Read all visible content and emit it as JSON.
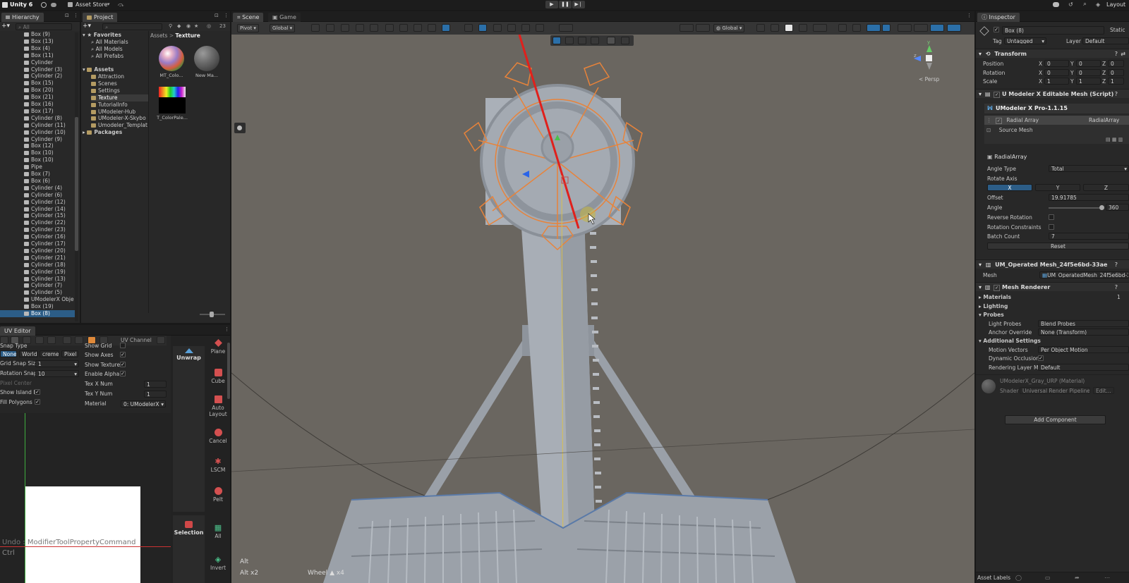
{
  "topbar": {
    "app": "Unity 6",
    "asset_store": "Asset Store",
    "layout": "Layout"
  },
  "hierarchy": {
    "tab": "Hierarchy",
    "search_placeholder": "All",
    "items": [
      "Box (9)",
      "Box (13)",
      "Box (4)",
      "Box (11)",
      "Cylinder",
      "Cylinder (3)",
      "Cylinder (2)",
      "Box (15)",
      "Box (20)",
      "Box (21)",
      "Box (16)",
      "Box (17)",
      "Cylinder (8)",
      "Cylinder (11)",
      "Cylinder (10)",
      "Cylinder (9)",
      "Box (12)",
      "Box (10)",
      "Box (10)",
      "Pipe",
      "Box (7)",
      "Box (6)",
      "Cylinder (4)",
      "Cylinder (6)",
      "Cylinder (12)",
      "Cylinder (14)",
      "Cylinder (15)",
      "Cylinder (22)",
      "Cylinder (23)",
      "Cylinder (16)",
      "Cylinder (17)",
      "Cylinder (20)",
      "Cylinder (21)",
      "Cylinder (18)",
      "Cylinder (19)",
      "Cylinder (13)",
      "Cylinder (7)",
      "Cylinder (5)",
      "UModelerX Obje",
      "Box (19)",
      "Box (8)"
    ],
    "selected_index": 40
  },
  "project": {
    "tab": "Project",
    "count": "23",
    "favorites": "Favorites",
    "fav_items": [
      "All Materials",
      "All Models",
      "All Prefabs"
    ],
    "assets": "Assets",
    "asset_folders": [
      "Attraction",
      "Scenes",
      "Settings",
      "Texture",
      "TutorialInfo",
      "UModeler-Hub",
      "UModeler-X-Skybo",
      "Umodeler_Templat"
    ],
    "selected_folder": "Texture",
    "packages": "Packages",
    "breadcrumb_root": "Assets",
    "breadcrumb_sep": ">",
    "breadcrumb_leaf": "Textture",
    "files": [
      "MT_Colo...",
      "New Ma...",
      "T_ColorPale..."
    ]
  },
  "uv_editor": {
    "tab": "UV Editor",
    "channel": "UV Channel",
    "snap_type_label": "Snap Type",
    "snap_options": [
      "None",
      "World",
      "creme",
      "Pixel"
    ],
    "grid_snap_label": "Grid Snap Siz",
    "grid_snap_value": "1",
    "rotation_snap_label": "Rotation Snap",
    "rotation_snap_value": "10",
    "pixel_center_label": "Pixel Center",
    "show_island_label": "Show Island B",
    "fill_polygons_label": "Fill Polygons",
    "show_grid_label": "Show Grid",
    "show_axes_label": "Show Axes",
    "show_texture_label": "Show Texture",
    "enable_alpha_label": "Enable Alpha",
    "tex_x_label": "Tex X Num",
    "tex_x_value": "1",
    "tex_y_label": "Tex Y Num",
    "tex_y_value": "1",
    "material_label": "Material",
    "material_value": "0: UModelerX_",
    "unwrap": "Unwrap",
    "selection": "Selection",
    "tools": [
      "Plane",
      "Cube",
      "Auto Layout",
      "Cancel",
      "LSCM",
      "Pelt"
    ],
    "tools2": [
      "All",
      "Invert"
    ],
    "undo_text": "Undo : ModifierToolPropertyCommand",
    "ctrl_text": "Ctrl"
  },
  "scene": {
    "tabs": [
      "Scene",
      "Game"
    ],
    "pivot": "Pivot",
    "global": "Global",
    "global2": "Global",
    "persp": "< Persp",
    "axis_y": "y",
    "axis_z": "z",
    "overlay_alt": "Alt",
    "overlay_alt2": "Alt x2",
    "overlay_wheel": "Wheel",
    "overlay_wheel_count": "x4"
  },
  "inspector": {
    "tab": "Inspector",
    "object_name": "Box (8)",
    "static": "Static",
    "tag_label": "Tag",
    "tag_value": "Untagged",
    "layer_label": "Layer",
    "layer_value": "Default",
    "transform": "Transform",
    "position": "Position",
    "rotation": "Rotation",
    "scale": "Scale",
    "pos": [
      "0",
      "0",
      "0"
    ],
    "rot": [
      "0",
      "0",
      "0"
    ],
    "scl": [
      "1",
      "1",
      "1"
    ],
    "axis_labels": [
      "X",
      "Y",
      "Z"
    ],
    "umx_component": "U Modeler X Editable Mesh (Script)",
    "umx_version": "UModeler X Pro-1.1.15",
    "radial_array_row": "Radial Array",
    "radial_array_tag": "RadialArray",
    "source_mesh": "Source Mesh",
    "radial_title": "RadialArray",
    "angle_type_label": "Angle Type",
    "angle_type_value": "Total",
    "rotate_axis_label": "Rotate Axis",
    "offset_label": "Offset",
    "offset_value": "19.91785",
    "angle_label": "Angle",
    "angle_value": "360",
    "reverse_rotation_label": "Reverse Rotation",
    "rotation_constraints_label": "Rotation Constraints",
    "batch_count_label": "Batch Count",
    "batch_count_value": "7",
    "reset": "Reset",
    "operated_mesh": "UM_Operated Mesh_24f5e6bd-33ae",
    "mesh_label": "Mesh",
    "mesh_value": "UM_OperatedMesh_24f5e6bd-3",
    "mesh_renderer": "Mesh Renderer",
    "materials": "Materials",
    "materials_count": "1",
    "lighting": "Lighting",
    "probes": "Probes",
    "light_probes_label": "Light Probes",
    "light_probes_value": "Blend Probes",
    "anchor_label": "Anchor Override",
    "anchor_value": "None (Transform)",
    "additional": "Additional Settings",
    "motion_label": "Motion Vectors",
    "motion_value": "Per Object Motion",
    "dyn_occ_label": "Dynamic Occlusion",
    "rendering_layer_label": "Rendering Layer Ma",
    "rendering_layer_value": "Default",
    "material_name": "UModelerX_Gray_URP (Material)",
    "shader_label": "Shader",
    "shader_value": "Universal Render Pipeline",
    "edit": "Edit...",
    "add_component": "Add Component",
    "asset_labels": "Asset Labels"
  },
  "colors": {
    "selection": "#2c5d87",
    "highlight_orange": "#e8833a",
    "gizmo_red": "#e0201c",
    "scene_bg": "#6a6660",
    "model": "#a8aeb6"
  }
}
